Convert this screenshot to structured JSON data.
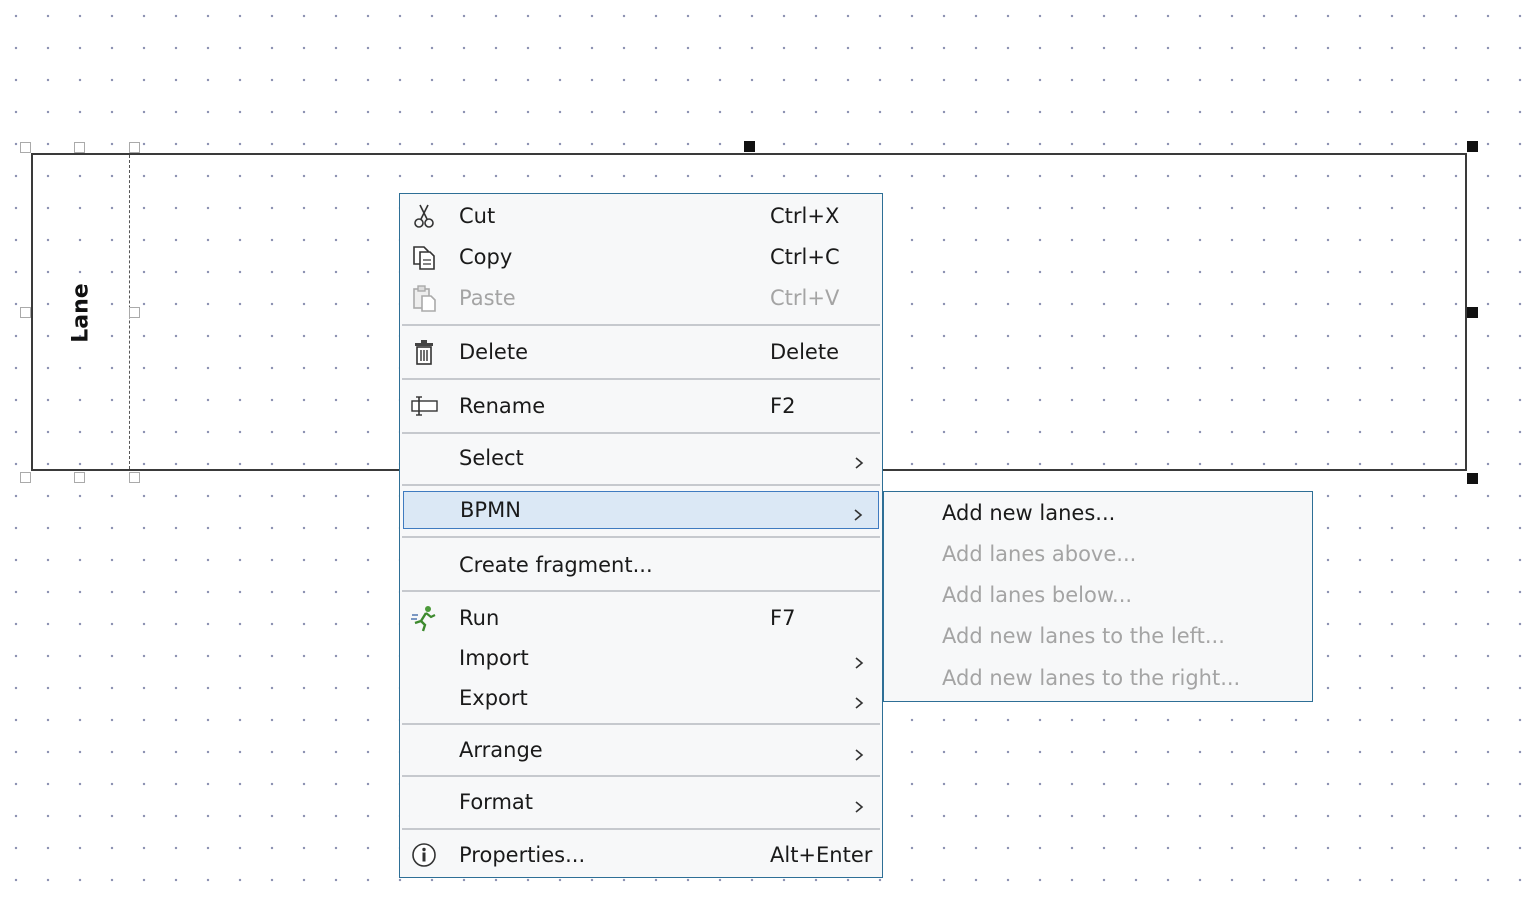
{
  "lane": {
    "label": "Lane"
  },
  "context_menu": {
    "items": [
      {
        "label": "Cut",
        "shortcut": "Ctrl+X",
        "icon": "scissors-icon",
        "enabled": true
      },
      {
        "label": "Copy",
        "shortcut": "Ctrl+C",
        "icon": "copy-icon",
        "enabled": true
      },
      {
        "label": "Paste",
        "shortcut": "Ctrl+V",
        "icon": "paste-icon",
        "enabled": false
      },
      {
        "label": "Delete",
        "shortcut": "Delete",
        "icon": "trash-icon",
        "enabled": true
      },
      {
        "label": "Rename",
        "shortcut": "F2",
        "icon": "rename-icon",
        "enabled": true
      },
      {
        "label": "Select",
        "has_submenu": true,
        "enabled": true
      },
      {
        "label": "BPMN",
        "has_submenu": true,
        "enabled": true,
        "highlighted": true
      },
      {
        "label": "Create fragment...",
        "enabled": true
      },
      {
        "label": "Run",
        "shortcut": "F7",
        "icon": "run-icon",
        "enabled": true
      },
      {
        "label": "Import",
        "has_submenu": true,
        "enabled": true
      },
      {
        "label": "Export",
        "has_submenu": true,
        "enabled": true
      },
      {
        "label": "Arrange",
        "has_submenu": true,
        "enabled": true
      },
      {
        "label": "Format",
        "has_submenu": true,
        "enabled": true
      },
      {
        "label": "Properties...",
        "shortcut": "Alt+Enter",
        "icon": "info-icon",
        "enabled": true
      }
    ]
  },
  "bpmn_submenu": {
    "items": [
      {
        "label": "Add new lanes...",
        "enabled": true
      },
      {
        "label": "Add lanes above...",
        "enabled": false
      },
      {
        "label": "Add lanes below...",
        "enabled": false
      },
      {
        "label": "Add new lanes to the left...",
        "enabled": false
      },
      {
        "label": "Add new lanes to the right...",
        "enabled": false
      }
    ]
  },
  "colors": {
    "menu_border": "#2e6f96",
    "highlight_bg": "#dbe8f5",
    "highlight_border": "#3f7bc0",
    "disabled_text": "#a4a4a4",
    "grid_dot": "#8a8fb0"
  }
}
